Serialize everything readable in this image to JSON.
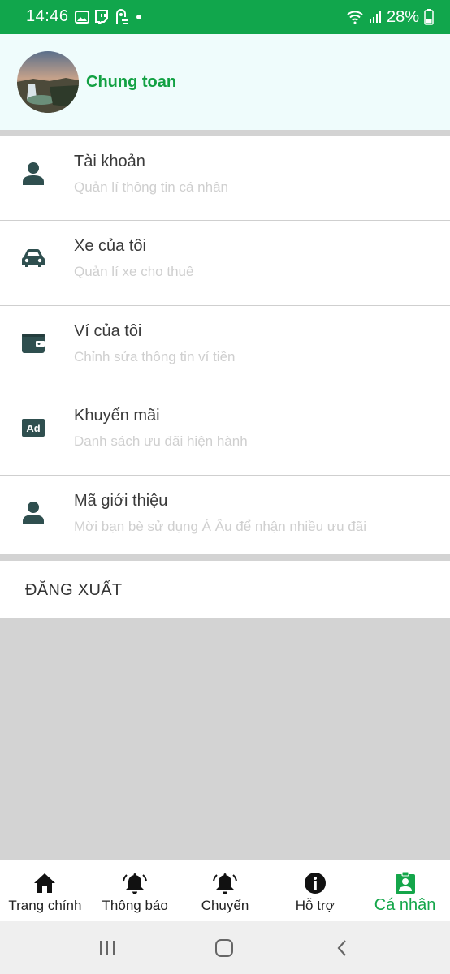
{
  "status_bar": {
    "time": "14:46",
    "battery": "28%",
    "left_icons": [
      "gallery-icon",
      "twitch-icon",
      "app-notification-icon",
      "dot-icon"
    ],
    "right_icons": [
      "wifi-icon",
      "signal-icon",
      "battery-icon"
    ]
  },
  "profile": {
    "name": "Chung toan",
    "avatar": "landscape-avatar"
  },
  "menu": {
    "items": [
      {
        "title": "Tài khoản",
        "subtitle": "Quản lí thông tin cá nhân",
        "icon": "person-icon"
      },
      {
        "title": "Xe của tôi",
        "subtitle": "Quản lí xe cho thuê",
        "icon": "car-icon"
      },
      {
        "title": "Ví của tôi",
        "subtitle": "Chỉnh sửa thông tin ví tiền",
        "icon": "wallet-icon"
      },
      {
        "title": "Khuyến mãi",
        "subtitle": "Danh sách ưu đãi hiện hành",
        "icon": "ad-icon"
      },
      {
        "title": "Mã giới thiệu",
        "subtitle": "Mời bạn bè sử dụng Á Âu để nhận nhiều ưu đãi",
        "icon": "person-icon"
      }
    ]
  },
  "logout": {
    "label": "ĐĂNG XUẤT"
  },
  "bottom_nav": {
    "active": "Cá nhân",
    "items": [
      {
        "label": "Trang chính",
        "icon": "home-icon"
      },
      {
        "label": "Thông báo",
        "icon": "bell-ring-icon"
      },
      {
        "label": "Chuyến",
        "icon": "bell-ring-icon"
      },
      {
        "label": "Hỗ trợ",
        "icon": "info-icon"
      },
      {
        "label": "Cá nhân",
        "icon": "contact-badge-icon"
      }
    ]
  },
  "colors": {
    "brand_green": "#11a64c",
    "header_bg": "#effcfc",
    "icon_dark": "#2f4f4f",
    "subtitle_gray": "#cfcfcf"
  }
}
